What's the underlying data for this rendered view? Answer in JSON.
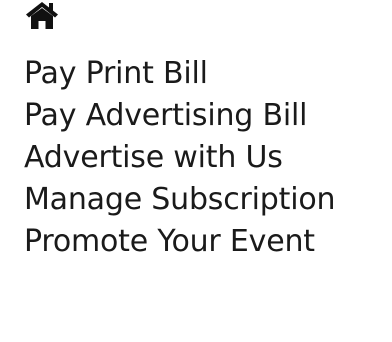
{
  "icons": {
    "home": "home-icon"
  },
  "menu": {
    "items": [
      {
        "label": "Pay Print Bill"
      },
      {
        "label": "Pay Advertising Bill"
      },
      {
        "label": "Advertise with Us"
      },
      {
        "label": "Manage Subscription"
      },
      {
        "label": "Promote Your Event"
      }
    ]
  }
}
